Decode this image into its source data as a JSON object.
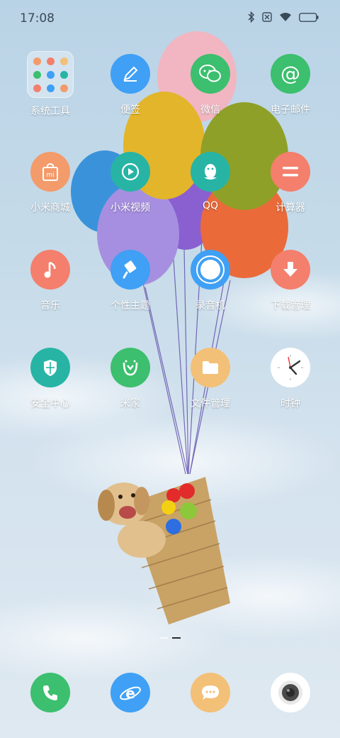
{
  "status_bar": {
    "time": "17:08",
    "icons": [
      "bluetooth-icon",
      "no-sim-icon",
      "wifi-icon",
      "battery-icon"
    ]
  },
  "apps": [
    {
      "label": "系统工具",
      "icon": "folder-icon",
      "color": "#ffffff"
    },
    {
      "label": "便签",
      "icon": "pencil-icon",
      "color": "#3fa0f5"
    },
    {
      "label": "微信",
      "icon": "wechat-icon",
      "color": "#3cbf6e"
    },
    {
      "label": "电子邮件",
      "icon": "at-sign-icon",
      "color": "#3cbf6e"
    },
    {
      "label": "小米商城",
      "icon": "mi-bag-icon",
      "color": "#f39b6a"
    },
    {
      "label": "小米视频",
      "icon": "play-icon",
      "color": "#27b4a5"
    },
    {
      "label": "QQ",
      "icon": "penguin-icon",
      "color": "#27b4a5"
    },
    {
      "label": "计算器",
      "icon": "equals-icon",
      "color": "#f47f6d"
    },
    {
      "label": "音乐",
      "icon": "music-note-icon",
      "color": "#f47f6d"
    },
    {
      "label": "个性主题",
      "icon": "paintbrush-icon",
      "color": "#3fa0f5"
    },
    {
      "label": "录音机",
      "icon": "record-icon",
      "color": "#3fa0f5"
    },
    {
      "label": "下载管理",
      "icon": "download-icon",
      "color": "#f47f6d"
    },
    {
      "label": "安全中心",
      "icon": "shield-icon",
      "color": "#27b4a5"
    },
    {
      "label": "米家",
      "icon": "mijia-icon",
      "color": "#3cbf6e"
    },
    {
      "label": "文件管理",
      "icon": "file-folder-icon",
      "color": "#f3c078"
    },
    {
      "label": "时钟",
      "icon": "clock-icon",
      "color": "#ffffff"
    }
  ],
  "page_indicator": {
    "pages": 2,
    "current": 2
  },
  "dock": [
    {
      "name": "phone",
      "icon": "phone-icon",
      "color": "#3cbf6e"
    },
    {
      "name": "browser",
      "icon": "browser-icon",
      "color": "#3fa0f5"
    },
    {
      "name": "messages",
      "icon": "message-icon",
      "color": "#f3c078"
    },
    {
      "name": "camera",
      "icon": "camera-icon",
      "color": "#ffffff"
    }
  ]
}
